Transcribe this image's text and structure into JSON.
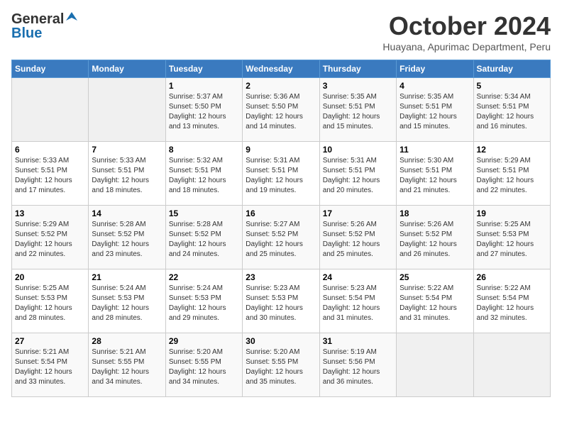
{
  "logo": {
    "general": "General",
    "blue": "Blue"
  },
  "title": "October 2024",
  "subtitle": "Huayana, Apurimac Department, Peru",
  "days_of_week": [
    "Sunday",
    "Monday",
    "Tuesday",
    "Wednesday",
    "Thursday",
    "Friday",
    "Saturday"
  ],
  "weeks": [
    [
      {
        "day": "",
        "info": ""
      },
      {
        "day": "",
        "info": ""
      },
      {
        "day": "1",
        "info": "Sunrise: 5:37 AM\nSunset: 5:50 PM\nDaylight: 12 hours and 13 minutes."
      },
      {
        "day": "2",
        "info": "Sunrise: 5:36 AM\nSunset: 5:50 PM\nDaylight: 12 hours and 14 minutes."
      },
      {
        "day": "3",
        "info": "Sunrise: 5:35 AM\nSunset: 5:51 PM\nDaylight: 12 hours and 15 minutes."
      },
      {
        "day": "4",
        "info": "Sunrise: 5:35 AM\nSunset: 5:51 PM\nDaylight: 12 hours and 15 minutes."
      },
      {
        "day": "5",
        "info": "Sunrise: 5:34 AM\nSunset: 5:51 PM\nDaylight: 12 hours and 16 minutes."
      }
    ],
    [
      {
        "day": "6",
        "info": "Sunrise: 5:33 AM\nSunset: 5:51 PM\nDaylight: 12 hours and 17 minutes."
      },
      {
        "day": "7",
        "info": "Sunrise: 5:33 AM\nSunset: 5:51 PM\nDaylight: 12 hours and 18 minutes."
      },
      {
        "day": "8",
        "info": "Sunrise: 5:32 AM\nSunset: 5:51 PM\nDaylight: 12 hours and 18 minutes."
      },
      {
        "day": "9",
        "info": "Sunrise: 5:31 AM\nSunset: 5:51 PM\nDaylight: 12 hours and 19 minutes."
      },
      {
        "day": "10",
        "info": "Sunrise: 5:31 AM\nSunset: 5:51 PM\nDaylight: 12 hours and 20 minutes."
      },
      {
        "day": "11",
        "info": "Sunrise: 5:30 AM\nSunset: 5:51 PM\nDaylight: 12 hours and 21 minutes."
      },
      {
        "day": "12",
        "info": "Sunrise: 5:29 AM\nSunset: 5:51 PM\nDaylight: 12 hours and 22 minutes."
      }
    ],
    [
      {
        "day": "13",
        "info": "Sunrise: 5:29 AM\nSunset: 5:52 PM\nDaylight: 12 hours and 22 minutes."
      },
      {
        "day": "14",
        "info": "Sunrise: 5:28 AM\nSunset: 5:52 PM\nDaylight: 12 hours and 23 minutes."
      },
      {
        "day": "15",
        "info": "Sunrise: 5:28 AM\nSunset: 5:52 PM\nDaylight: 12 hours and 24 minutes."
      },
      {
        "day": "16",
        "info": "Sunrise: 5:27 AM\nSunset: 5:52 PM\nDaylight: 12 hours and 25 minutes."
      },
      {
        "day": "17",
        "info": "Sunrise: 5:26 AM\nSunset: 5:52 PM\nDaylight: 12 hours and 25 minutes."
      },
      {
        "day": "18",
        "info": "Sunrise: 5:26 AM\nSunset: 5:52 PM\nDaylight: 12 hours and 26 minutes."
      },
      {
        "day": "19",
        "info": "Sunrise: 5:25 AM\nSunset: 5:53 PM\nDaylight: 12 hours and 27 minutes."
      }
    ],
    [
      {
        "day": "20",
        "info": "Sunrise: 5:25 AM\nSunset: 5:53 PM\nDaylight: 12 hours and 28 minutes."
      },
      {
        "day": "21",
        "info": "Sunrise: 5:24 AM\nSunset: 5:53 PM\nDaylight: 12 hours and 28 minutes."
      },
      {
        "day": "22",
        "info": "Sunrise: 5:24 AM\nSunset: 5:53 PM\nDaylight: 12 hours and 29 minutes."
      },
      {
        "day": "23",
        "info": "Sunrise: 5:23 AM\nSunset: 5:53 PM\nDaylight: 12 hours and 30 minutes."
      },
      {
        "day": "24",
        "info": "Sunrise: 5:23 AM\nSunset: 5:54 PM\nDaylight: 12 hours and 31 minutes."
      },
      {
        "day": "25",
        "info": "Sunrise: 5:22 AM\nSunset: 5:54 PM\nDaylight: 12 hours and 31 minutes."
      },
      {
        "day": "26",
        "info": "Sunrise: 5:22 AM\nSunset: 5:54 PM\nDaylight: 12 hours and 32 minutes."
      }
    ],
    [
      {
        "day": "27",
        "info": "Sunrise: 5:21 AM\nSunset: 5:54 PM\nDaylight: 12 hours and 33 minutes."
      },
      {
        "day": "28",
        "info": "Sunrise: 5:21 AM\nSunset: 5:55 PM\nDaylight: 12 hours and 34 minutes."
      },
      {
        "day": "29",
        "info": "Sunrise: 5:20 AM\nSunset: 5:55 PM\nDaylight: 12 hours and 34 minutes."
      },
      {
        "day": "30",
        "info": "Sunrise: 5:20 AM\nSunset: 5:55 PM\nDaylight: 12 hours and 35 minutes."
      },
      {
        "day": "31",
        "info": "Sunrise: 5:19 AM\nSunset: 5:56 PM\nDaylight: 12 hours and 36 minutes."
      },
      {
        "day": "",
        "info": ""
      },
      {
        "day": "",
        "info": ""
      }
    ]
  ]
}
